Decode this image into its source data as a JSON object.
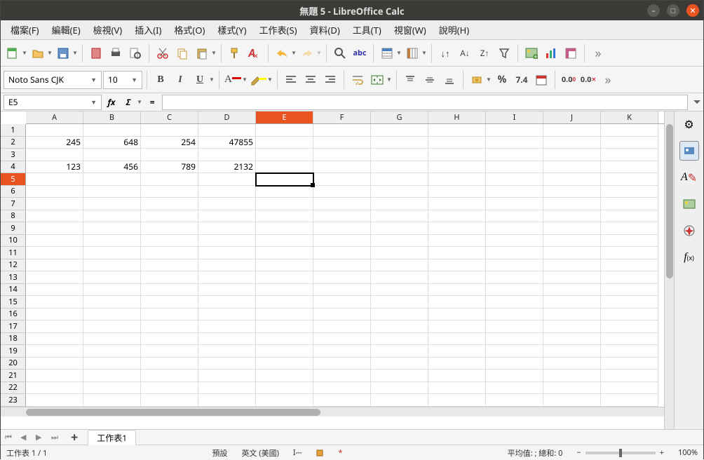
{
  "title": "無題 5 - LibreOffice Calc",
  "menu": [
    "檔案(F)",
    "編輯(E)",
    "檢視(V)",
    "插入(I)",
    "格式(O)",
    "樣式(Y)",
    "工作表(S)",
    "資料(D)",
    "工具(T)",
    "視窗(W)",
    "說明(H)"
  ],
  "font": {
    "name": "Noto Sans CJK",
    "size": "10"
  },
  "namebox": "E5",
  "formula": "",
  "columns": [
    "A",
    "B",
    "C",
    "D",
    "E",
    "F",
    "G",
    "H",
    "I",
    "J",
    "K"
  ],
  "active_col_index": 4,
  "row_count": 23,
  "active_row": 5,
  "selected_cell": {
    "row": 5,
    "col": 4
  },
  "cells": {
    "2": {
      "0": "245",
      "1": "648",
      "2": "254",
      "3": "47855"
    },
    "4": {
      "0": "123",
      "1": "456",
      "2": "789",
      "3": "2132"
    }
  },
  "sheet_tab": "工作表1",
  "status": {
    "sheetpos": "工作表 1 / 1",
    "style": "預設",
    "lang": "英文 (美國)",
    "aggregate": "平均值: ; 總和: 0",
    "zoom": "100%"
  },
  "fmt_nums": {
    "percent": "%",
    "num": "7.4"
  }
}
